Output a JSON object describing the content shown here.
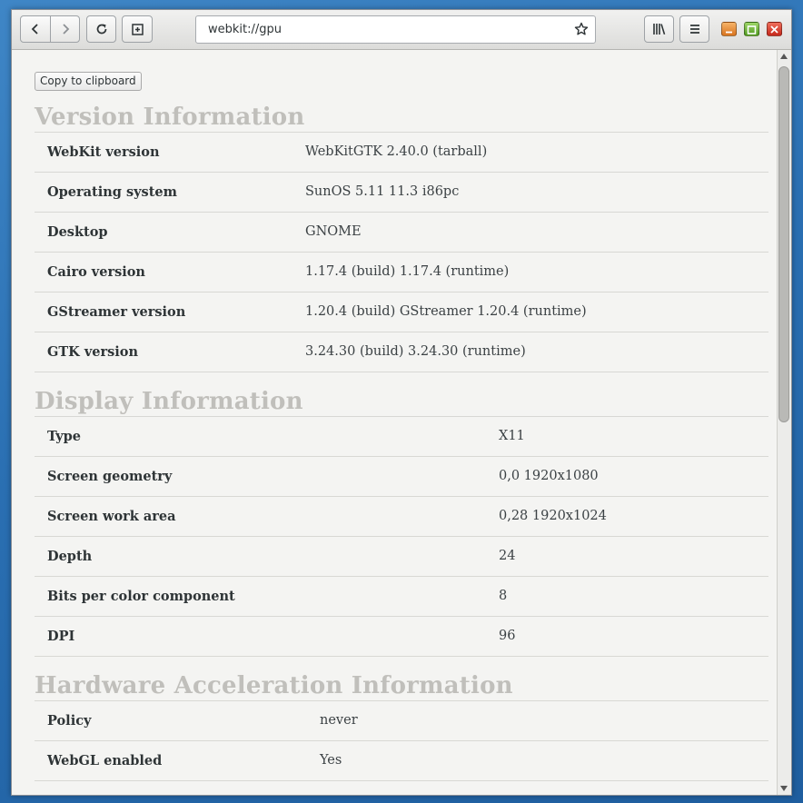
{
  "browser": {
    "url": "webkit://gpu",
    "icons": {
      "back": "chevron-left-icon",
      "forward": "chevron-right-icon",
      "reload": "reload-icon",
      "new_tab": "new-tab-icon",
      "bookmark": "star-icon",
      "library": "library-icon",
      "menu": "hamburger-menu-icon"
    }
  },
  "page": {
    "copy_button": "Copy to clipboard",
    "sections": [
      {
        "title": "Version Information",
        "rows": [
          {
            "key": "WebKit version",
            "value": "WebKitGTK 2.40.0 (tarball)"
          },
          {
            "key": "Operating system",
            "value": "SunOS 5.11 11.3 i86pc"
          },
          {
            "key": "Desktop",
            "value": "GNOME"
          },
          {
            "key": "Cairo version",
            "value": "1.17.4 (build) 1.17.4 (runtime)"
          },
          {
            "key": "GStreamer version",
            "value": "1.20.4 (build) GStreamer 1.20.4 (runtime)"
          },
          {
            "key": "GTK version",
            "value": "3.24.30 (build) 3.24.30 (runtime)"
          }
        ]
      },
      {
        "title": "Display Information",
        "rows": [
          {
            "key": "Type",
            "value": "X11"
          },
          {
            "key": "Screen geometry",
            "value": "0,0 1920x1080"
          },
          {
            "key": "Screen work area",
            "value": "0,28 1920x1024"
          },
          {
            "key": "Depth",
            "value": "24"
          },
          {
            "key": "Bits per color component",
            "value": "8"
          },
          {
            "key": "DPI",
            "value": "96"
          }
        ]
      },
      {
        "title": "Hardware Acceleration Information",
        "rows": [
          {
            "key": "Policy",
            "value": "never"
          },
          {
            "key": "WebGL enabled",
            "value": "Yes"
          }
        ]
      }
    ]
  }
}
